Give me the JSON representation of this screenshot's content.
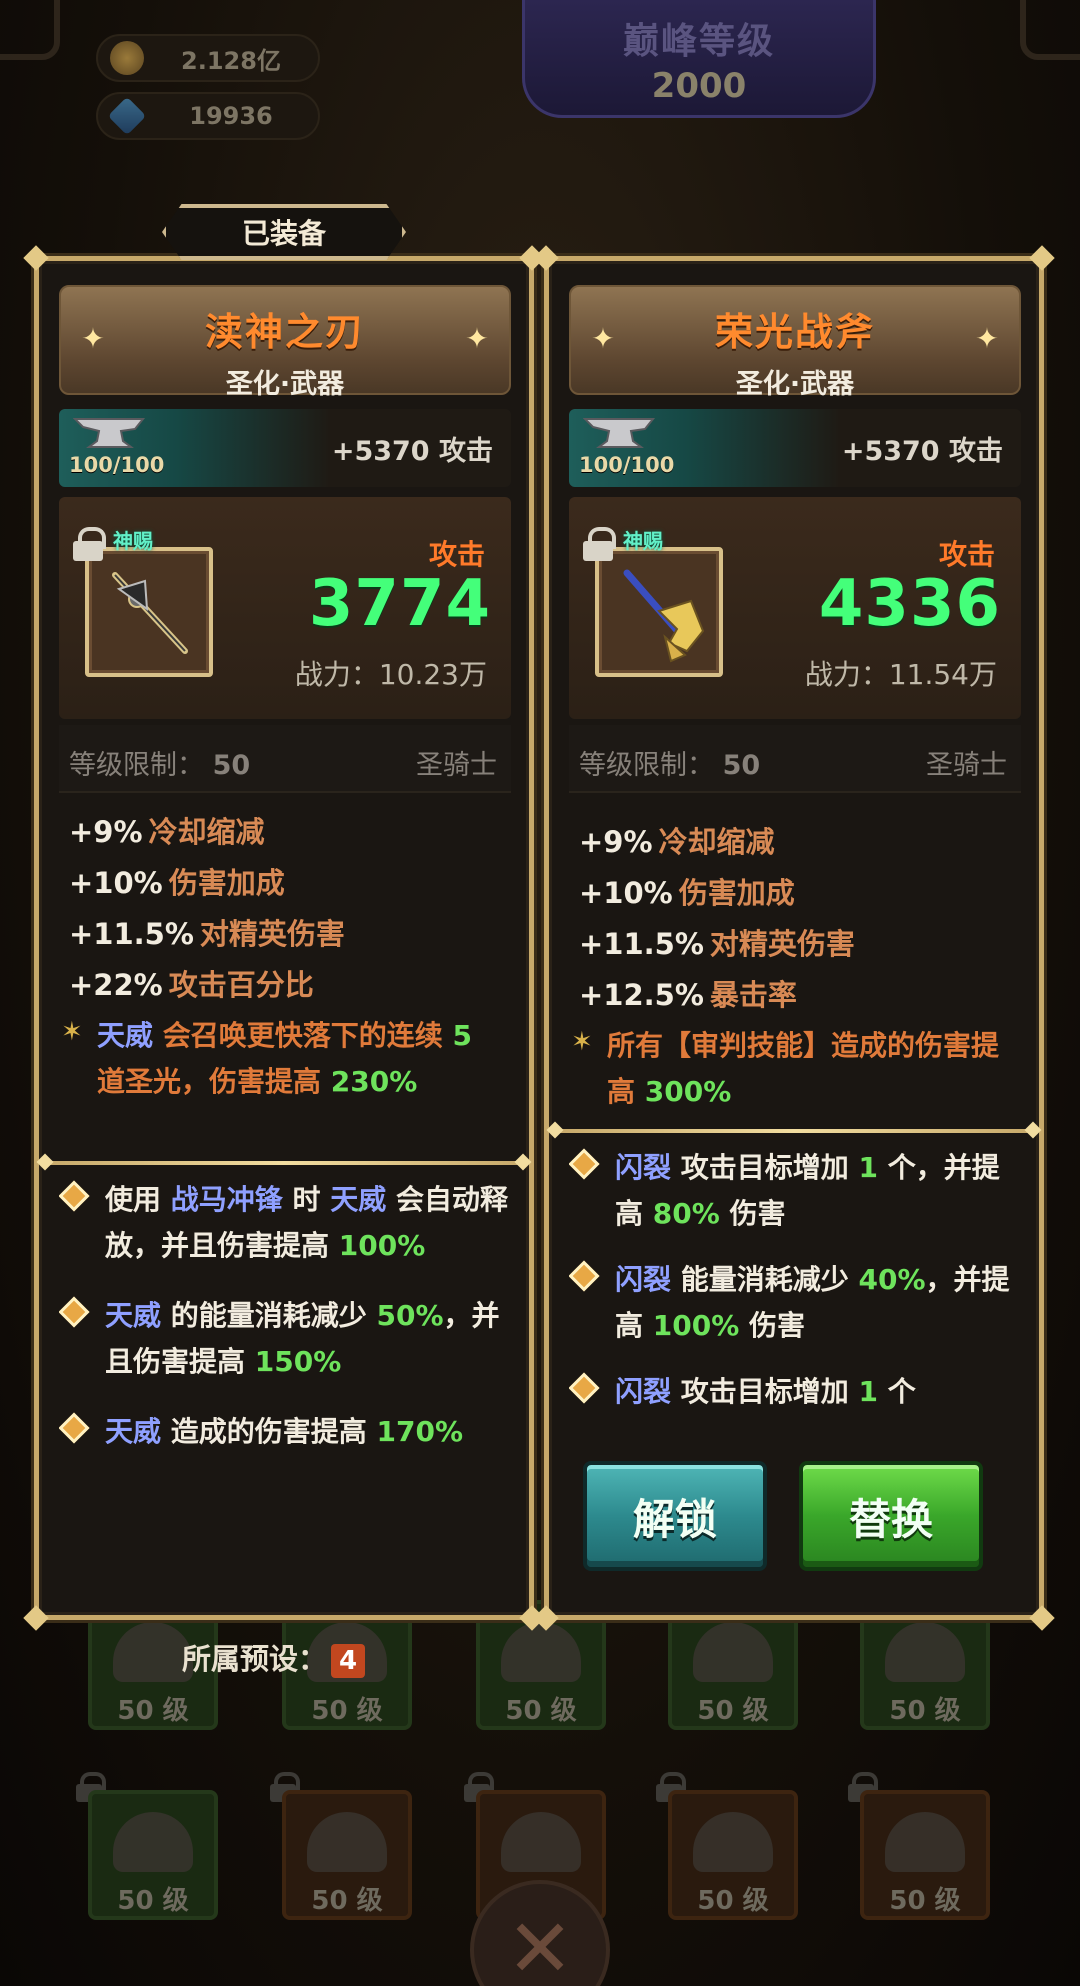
{
  "background": {
    "currency": [
      {
        "icon": "gold-coin-icon",
        "value": "2.128亿"
      },
      {
        "icon": "gem-icon",
        "value": "19936"
      }
    ],
    "peak_level": {
      "title": "巅峰等级",
      "value": "2000"
    },
    "slot_level_label": "50 级"
  },
  "equipped_tab": "已装备",
  "left_card": {
    "name": "渎神之刃",
    "type": "圣化·武器",
    "anvil_count": "100/100",
    "anvil_attack": "+5370 攻击",
    "gift_label": "神赐",
    "stat_label": "攻击",
    "stat_value": "3774",
    "power_label": "战力：",
    "power_value": "10.23万",
    "req_label": "等级限制：",
    "req_value": "50",
    "req_class": "圣骑士",
    "affixes": [
      {
        "value": "+9%",
        "text": "冷却缩减"
      },
      {
        "value": "+10%",
        "text": "伤害加成"
      },
      {
        "value": "+11.5%",
        "text": "对精英伤害"
      },
      {
        "value": "+22%",
        "text": "攻击百分比"
      }
    ],
    "set_bonus": {
      "kw": "天威",
      "p1": " 会召唤更快落下的连续 ",
      "n1": "5",
      "p2": " 道圣光，伤害提高 ",
      "n2": "230%"
    },
    "passives": [
      {
        "a": "使用 ",
        "kw1": "战马冲锋",
        "b": " 时 ",
        "kw2": "天威",
        "c": " 会自动释放，并且伤害提高 ",
        "n": "100%"
      },
      {
        "kw": "天威",
        "a": " 的能量消耗减少 ",
        "n1": "50%",
        "b": "，并且伤害提高 ",
        "n2": "150%"
      },
      {
        "kw": "天威",
        "a": " 造成的伤害提高 ",
        "n": "170%"
      }
    ]
  },
  "right_card": {
    "name": "荣光战斧",
    "type": "圣化·武器",
    "anvil_count": "100/100",
    "anvil_attack": "+5370 攻击",
    "gift_label": "神赐",
    "stat_label": "攻击",
    "stat_value": "4336",
    "power_label": "战力：",
    "power_value": "11.54万",
    "req_label": "等级限制：",
    "req_value": "50",
    "req_class": "圣骑士",
    "affixes": [
      {
        "value": "+9%",
        "text": "冷却缩减"
      },
      {
        "value": "+10%",
        "text": "伤害加成"
      },
      {
        "value": "+11.5%",
        "text": "对精英伤害"
      },
      {
        "value": "+12.5%",
        "text": "暴击率"
      }
    ],
    "set_bonus": {
      "p1": "所有【审判技能】造成的伤害提高 ",
      "n1": "300%"
    },
    "passives": [
      {
        "kw": "闪裂",
        "a": " 攻击目标增加 ",
        "n1": "1",
        "b": " 个，并提高 ",
        "n2": "80%",
        "c": " 伤害"
      },
      {
        "kw": "闪裂",
        "a": " 能量消耗减少 ",
        "n1": "40%",
        "b": "，并提高 ",
        "n2": "100%",
        "c": " 伤害"
      },
      {
        "kw": "闪裂",
        "a": " 攻击目标增加 ",
        "n1": "1",
        "b": " 个"
      }
    ],
    "buttons": {
      "unlock": "解锁",
      "replace": "替换"
    }
  },
  "preset": {
    "label": "所属预设：",
    "value": "4"
  },
  "colors": {
    "gold_frame": "#c7a96a",
    "attack_green": "#44ff7a",
    "name_orange": "#ff8a2e",
    "keyword_blue": "#8fa0ff",
    "number_green": "#6ee35c"
  }
}
